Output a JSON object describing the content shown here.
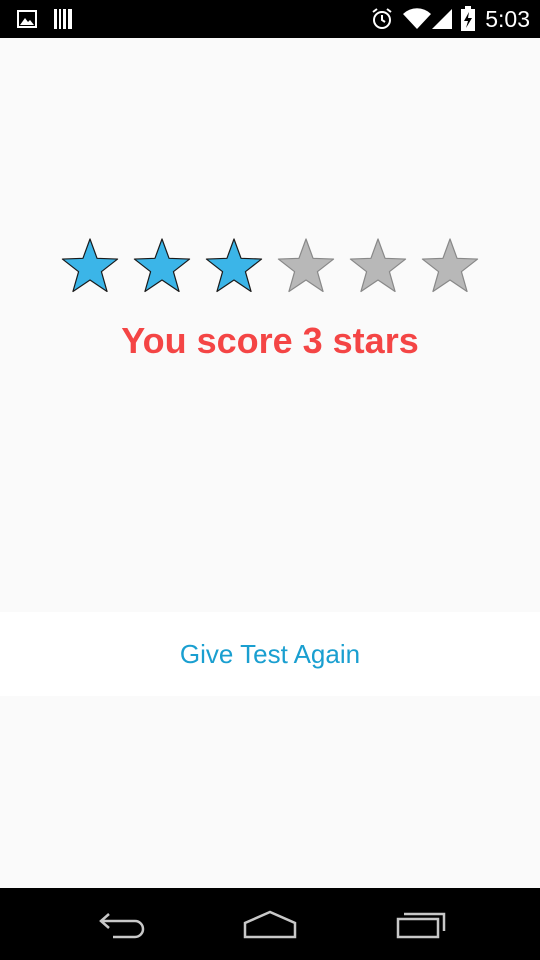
{
  "status_bar": {
    "time": "5:03",
    "icons": [
      "image-icon",
      "barcode-icon",
      "alarm-icon",
      "wifi-icon",
      "signal-icon",
      "battery-charging-icon"
    ]
  },
  "rating": {
    "score": 3,
    "max": 6,
    "filled_color": "#3bb5e8",
    "empty_color": "#b8b8b8"
  },
  "score_text": "You score 3 stars",
  "give_test_again_label": "Give Test Again",
  "colors": {
    "score_text": "#f44545",
    "button_text": "#1a9fd0"
  },
  "nav_bar": {
    "buttons": [
      "back-icon",
      "home-icon",
      "recents-icon"
    ]
  }
}
